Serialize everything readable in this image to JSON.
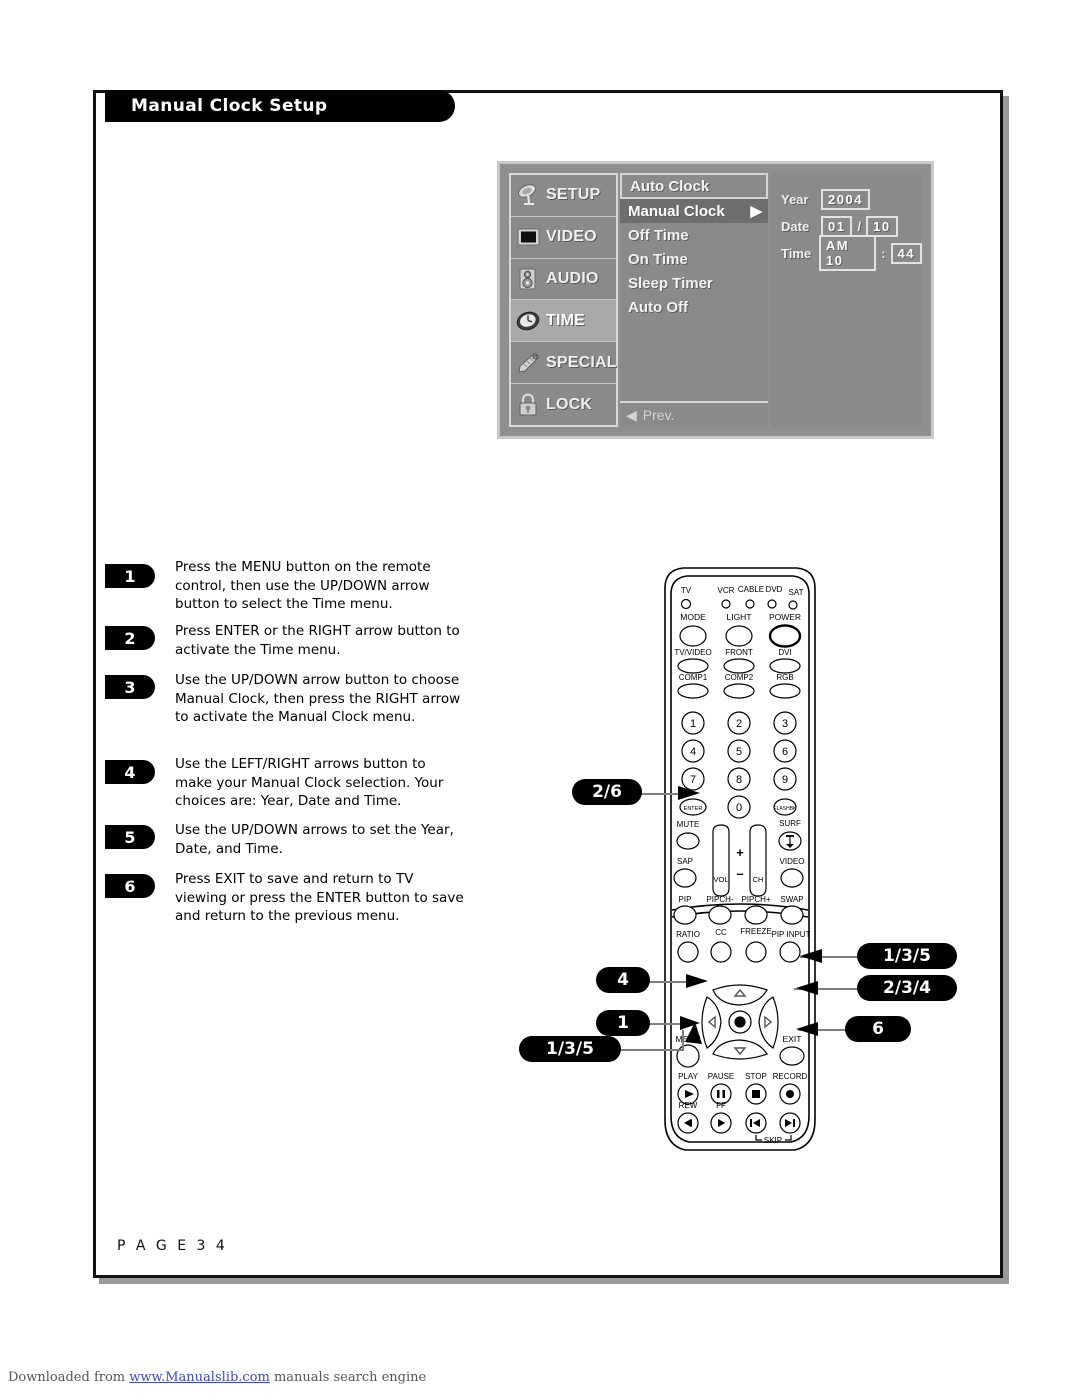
{
  "page": {
    "title": "Manual Clock Setup",
    "page_label": "P A G E   3 4",
    "footer_prefix": "Downloaded from ",
    "footer_link": "www.Manualslib.com",
    "footer_suffix": " manuals search engine"
  },
  "osd": {
    "sidebar": [
      {
        "label": "SETUP",
        "icon": "satellite-dish-icon",
        "active": false
      },
      {
        "label": "VIDEO",
        "icon": "monitor-icon",
        "active": false
      },
      {
        "label": "AUDIO",
        "icon": "speaker-icon",
        "active": false
      },
      {
        "label": "TIME",
        "icon": "clock-icon",
        "active": true
      },
      {
        "label": "SPECIAL",
        "icon": "tag-icon",
        "active": false
      },
      {
        "label": "LOCK",
        "icon": "padlock-icon",
        "active": false
      }
    ],
    "menu": [
      {
        "label": "Auto Clock",
        "state": "boxed",
        "arrow": ""
      },
      {
        "label": "Manual Clock",
        "state": "selected",
        "arrow": "▶"
      },
      {
        "label": "Off Time",
        "state": "normal",
        "arrow": ""
      },
      {
        "label": "On Time",
        "state": "normal",
        "arrow": ""
      },
      {
        "label": "Sleep Timer",
        "state": "normal",
        "arrow": ""
      },
      {
        "label": "Auto Off",
        "state": "normal",
        "arrow": ""
      }
    ],
    "prev_label": "Prev.",
    "prev_arrow": "◀",
    "values": [
      {
        "label": "Year",
        "box1": "2004",
        "sep": "",
        "box2": ""
      },
      {
        "label": "Date",
        "box1": "01",
        "sep": "/",
        "box2": "10"
      },
      {
        "label": "Time",
        "box1": "AM 10",
        "sep": ":",
        "box2": "44"
      }
    ]
  },
  "steps": [
    {
      "num": "1",
      "text": "Press the MENU button on the remote control, then use the UP/DOWN arrow button to select the Time menu."
    },
    {
      "num": "2",
      "text": "Press ENTER or the RIGHT arrow button to activate the Time menu."
    },
    {
      "num": "3",
      "text": "Use the UP/DOWN arrow button to choose Manual Clock, then press the RIGHT arrow to activate the Manual Clock menu."
    },
    {
      "num": "4",
      "text": "Use the LEFT/RIGHT arrows button to make your Manual Clock selection. Your choices are: Year, Date and Time."
    },
    {
      "num": "5",
      "text": "Use the UP/DOWN arrows to set the Year, Date, and Time."
    },
    {
      "num": "6",
      "text": "Press EXIT to save and return to TV viewing or press the ENTER button to save and return to the previous menu."
    }
  ],
  "callouts": {
    "enter": "2/6",
    "left_arrow": "4",
    "menu": "1",
    "down_arrow": "1/3/5",
    "up_arrow": "1/3/5",
    "right_arrow": "2/3/4",
    "exit": "6"
  },
  "remote": {
    "device_labels": [
      "TV",
      "VCR",
      "CABLE",
      "DVD",
      "SAT"
    ],
    "row_mode": [
      "MODE",
      "LIGHT",
      "POWER"
    ],
    "row_input1": [
      "TV/VIDEO",
      "FRONT",
      "DVI"
    ],
    "row_input2": [
      "COMP1",
      "COMP2",
      "RGB"
    ],
    "keypad": [
      "1",
      "2",
      "3",
      "4",
      "5",
      "6",
      "7",
      "8",
      "9",
      "0"
    ],
    "enter_label": "ENTER",
    "flashbk_label": "FLASHBK",
    "mute_label": "MUTE",
    "surf_label": "SURF",
    "sap_label": "SAP",
    "video_label": "VIDEO",
    "vol_label": "VOL",
    "ch_label": "CH",
    "plus_label": "+",
    "minus_label": "–",
    "row_pip": [
      "PIP",
      "PIPCH-",
      "PIPCH+",
      "SWAP"
    ],
    "row_ratio": [
      "RATIO",
      "CC",
      "FREEZE",
      "PIP INPUT"
    ],
    "menu_label": "MENU",
    "exit_label": "EXIT",
    "row_transport": [
      "PLAY",
      "PAUSE",
      "STOP",
      "RECORD"
    ],
    "row_transport2": [
      "REW",
      "FF"
    ],
    "skip_label": "SKIP"
  }
}
